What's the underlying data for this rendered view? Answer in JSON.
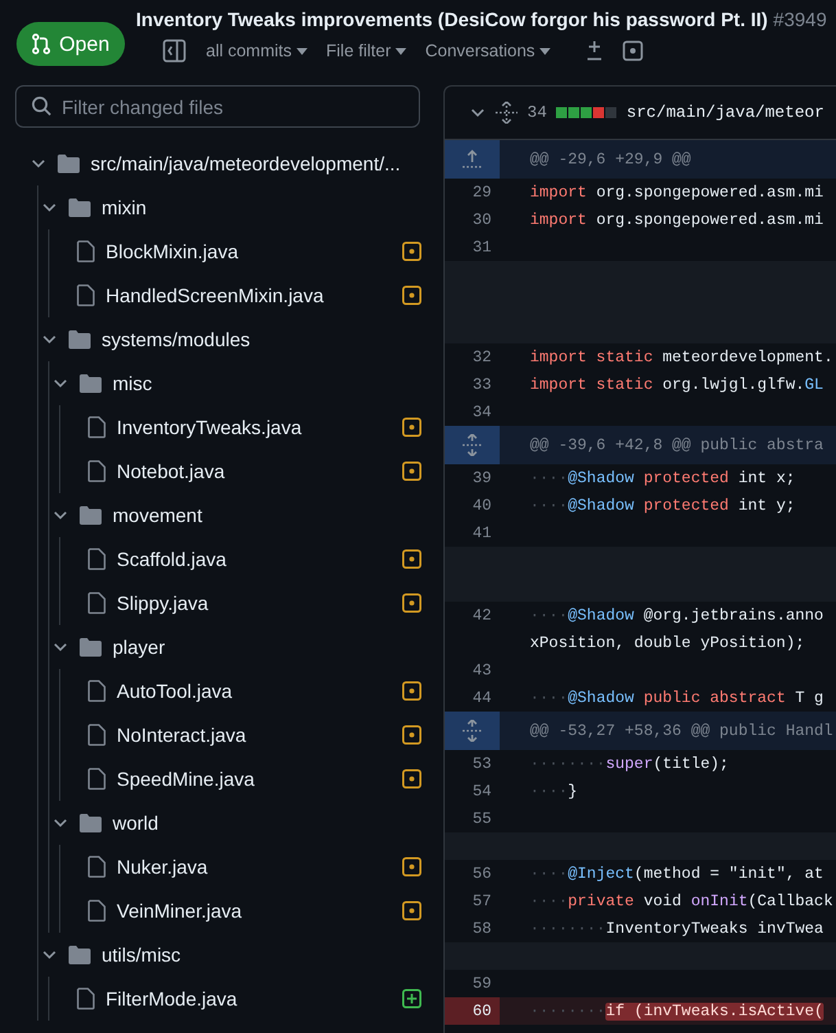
{
  "pull_request": {
    "status": "Open",
    "title": "Inventory Tweaks improvements (DesiCow forgor his password Pt. II)",
    "number": "#3949"
  },
  "toolbar": {
    "menus": [
      "all commits",
      "File filter",
      "Conversations"
    ]
  },
  "sidebar": {
    "search": {
      "placeholder": "Filter changed files"
    },
    "tree": [
      {
        "kind": "folder",
        "name": "src/main/java/meteordevelopment/...",
        "expanded": true,
        "children": [
          {
            "kind": "folder",
            "name": "mixin",
            "expanded": true,
            "children": [
              {
                "kind": "modified",
                "name": "BlockMixin.java"
              },
              {
                "kind": "modified",
                "name": "HandledScreenMixin.java"
              }
            ]
          },
          {
            "kind": "folder",
            "name": "systems/modules",
            "expanded": true,
            "children": [
              {
                "kind": "folder",
                "name": "misc",
                "expanded": true,
                "children": [
                  {
                    "kind": "modified",
                    "name": "InventoryTweaks.java"
                  },
                  {
                    "kind": "modified",
                    "name": "Notebot.java"
                  }
                ]
              },
              {
                "kind": "folder",
                "name": "movement",
                "expanded": true,
                "children": [
                  {
                    "kind": "modified",
                    "name": "Scaffold.java"
                  },
                  {
                    "kind": "modified",
                    "name": "Slippy.java"
                  }
                ]
              },
              {
                "kind": "folder",
                "name": "player",
                "expanded": true,
                "children": [
                  {
                    "kind": "modified",
                    "name": "AutoTool.java"
                  },
                  {
                    "kind": "modified",
                    "name": "NoInteract.java"
                  },
                  {
                    "kind": "modified",
                    "name": "SpeedMine.java"
                  }
                ]
              },
              {
                "kind": "folder",
                "name": "world",
                "expanded": true,
                "children": [
                  {
                    "kind": "modified",
                    "name": "Nuker.java"
                  },
                  {
                    "kind": "modified",
                    "name": "VeinMiner.java"
                  }
                ]
              }
            ]
          },
          {
            "kind": "folder",
            "name": "utils/misc",
            "expanded": true,
            "children": [
              {
                "kind": "added",
                "name": "FilterMode.java"
              }
            ]
          }
        ]
      }
    ]
  },
  "diff": {
    "expanded": true,
    "changes": "34",
    "stat": [
      {
        "color": "#2ea043"
      },
      {
        "color": "#2ea043"
      },
      {
        "color": "#2ea043"
      },
      {
        "color": "#da3633"
      },
      {
        "color": "#30363d"
      }
    ],
    "path": "src/main/java/meteor",
    "rows": [
      {
        "kind": "hunk_top",
        "text": "@@ -29,6 +29,9 @@"
      },
      {
        "kind": "line",
        "number": "29",
        "tokens": [
          {
            "kind": "keyword",
            "s": "import"
          },
          {
            "kind": "plain",
            "s": " org.spongepowered.asm.mi"
          }
        ]
      },
      {
        "kind": "line",
        "number": "30",
        "tokens": [
          {
            "kind": "keyword",
            "s": "import"
          },
          {
            "kind": "plain",
            "s": " org.spongepowered.asm.mi"
          }
        ]
      },
      {
        "kind": "line",
        "number": "31"
      },
      {
        "kind": "blank"
      },
      {
        "kind": "blank"
      },
      {
        "kind": "blank"
      },
      {
        "kind": "line",
        "number": "32",
        "tokens": [
          {
            "kind": "keyword",
            "s": "import static"
          },
          {
            "kind": "plain",
            "s": " meteordevelopment."
          }
        ]
      },
      {
        "kind": "line",
        "number": "33",
        "tokens": [
          {
            "kind": "keyword",
            "s": "import static"
          },
          {
            "kind": "plain",
            "s": " org.lwjgl.glfw."
          },
          {
            "kind": "constant",
            "s": "GL"
          }
        ]
      },
      {
        "kind": "line",
        "number": "34"
      },
      {
        "kind": "hunk",
        "text": "@@ -39,6 +42,8 @@ public abstra"
      },
      {
        "kind": "line",
        "number": "39",
        "tokens": [
          {
            "kind": "space",
            "s": "····"
          },
          {
            "kind": "constant",
            "s": "@Shadow"
          },
          {
            "kind": "keyword",
            "s": " protected"
          },
          {
            "kind": "plain",
            "s": " int x;"
          }
        ]
      },
      {
        "kind": "line",
        "number": "40",
        "tokens": [
          {
            "kind": "space",
            "s": "····"
          },
          {
            "kind": "constant",
            "s": "@Shadow"
          },
          {
            "kind": "keyword",
            "s": " protected"
          },
          {
            "kind": "plain",
            "s": " int y;"
          }
        ]
      },
      {
        "kind": "line",
        "number": "41"
      },
      {
        "kind": "blank"
      },
      {
        "kind": "blank"
      },
      {
        "kind": "line",
        "number": "42",
        "tokens": [
          {
            "kind": "space",
            "s": "····"
          },
          {
            "kind": "constant",
            "s": "@Shadow"
          },
          {
            "kind": "plain",
            "s": " @org.jetbrains.anno"
          }
        ]
      },
      {
        "kind": "wrap",
        "tokens": [
          {
            "kind": "plain",
            "s": "xPosition, double yPosition);"
          }
        ]
      },
      {
        "kind": "line",
        "number": "43"
      },
      {
        "kind": "line",
        "number": "44",
        "tokens": [
          {
            "kind": "space",
            "s": "····"
          },
          {
            "kind": "constant",
            "s": "@Shadow"
          },
          {
            "kind": "keyword",
            "s": " public abstract"
          },
          {
            "kind": "plain",
            "s": " T g"
          }
        ]
      },
      {
        "kind": "hunk",
        "text": "@@ -53,27 +58,36 @@ public Handl"
      },
      {
        "kind": "line",
        "number": "53",
        "tokens": [
          {
            "kind": "space",
            "s": "········"
          },
          {
            "kind": "function",
            "s": "super"
          },
          {
            "kind": "plain",
            "s": "(title);"
          }
        ]
      },
      {
        "kind": "line",
        "number": "54",
        "tokens": [
          {
            "kind": "space",
            "s": "····"
          },
          {
            "kind": "plain",
            "s": "}"
          }
        ]
      },
      {
        "kind": "line",
        "number": "55"
      },
      {
        "kind": "blank"
      },
      {
        "kind": "line",
        "number": "56",
        "tokens": [
          {
            "kind": "space",
            "s": "····"
          },
          {
            "kind": "constant",
            "s": "@Inject"
          },
          {
            "kind": "plain",
            "s": "(method = \"init\", at"
          }
        ]
      },
      {
        "kind": "line",
        "number": "57",
        "tokens": [
          {
            "kind": "space",
            "s": "····"
          },
          {
            "kind": "keyword",
            "s": "private"
          },
          {
            "kind": "plain",
            "s": " void"
          },
          {
            "kind": "function",
            "s": " onInit"
          },
          {
            "kind": "plain",
            "s": "(Callback"
          }
        ]
      },
      {
        "kind": "line",
        "number": "58",
        "tokens": [
          {
            "kind": "space",
            "s": "········"
          },
          {
            "kind": "plain",
            "s": "InventoryTweaks invTwea"
          }
        ]
      },
      {
        "kind": "blank"
      },
      {
        "kind": "line",
        "number": "59"
      },
      {
        "kind": "deleted",
        "number": "60",
        "tokens": [
          {
            "kind": "space",
            "s": "········"
          },
          {
            "kind": "highlight",
            "s": "if (invTweaks.isActive("
          }
        ]
      }
    ]
  }
}
